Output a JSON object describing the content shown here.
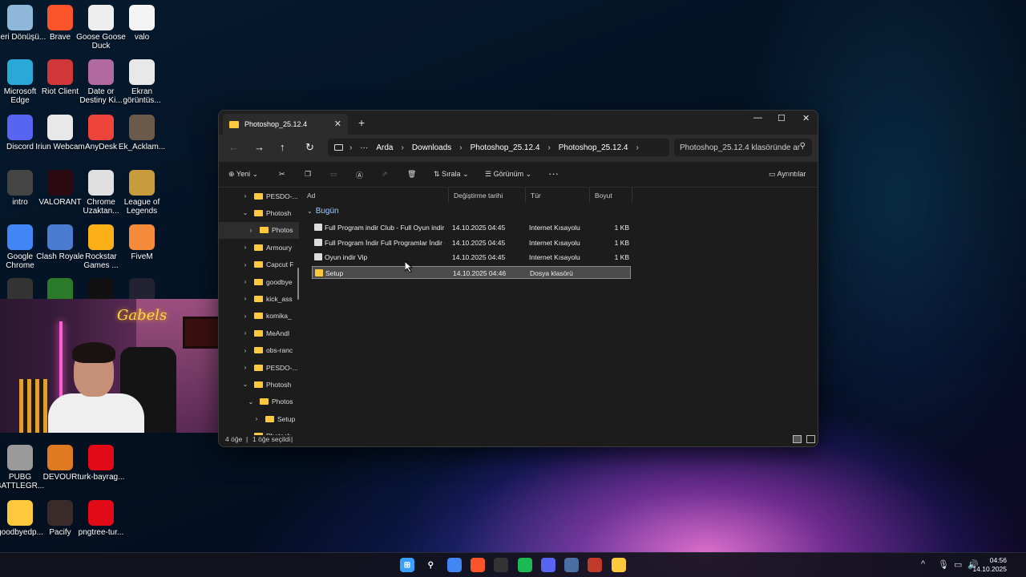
{
  "desktop_icons": [
    {
      "label": "Geri Dönüşü...",
      "icon": "recycle-bin-icon",
      "color": "#8fb7d9"
    },
    {
      "label": "Brave",
      "icon": "brave-icon",
      "color": "#fb542b"
    },
    {
      "label": "Goose Goose Duck",
      "icon": "goose-icon",
      "color": "#eeeeee"
    },
    {
      "label": "valo",
      "icon": "text-file-icon",
      "color": "#f4f4f4"
    },
    {
      "label": "Microsoft Edge",
      "icon": "edge-icon",
      "color": "#2aa8d8"
    },
    {
      "label": "Riot Client",
      "icon": "riot-icon",
      "color": "#d13639"
    },
    {
      "label": "Date or Destiny Ki...",
      "icon": "game-icon",
      "color": "#b06aa0"
    },
    {
      "label": "Ekran görüntüs...",
      "icon": "image-icon",
      "color": "#e8e8e8"
    },
    {
      "label": "Discord",
      "icon": "discord-icon",
      "color": "#5865f2"
    },
    {
      "label": "Iriun Webcam",
      "icon": "webcam-icon",
      "color": "#e8e8e8"
    },
    {
      "label": "AnyDesk",
      "icon": "anydesk-icon",
      "color": "#ef443b"
    },
    {
      "label": "Ek_Acklam...",
      "icon": "photo-icon",
      "color": "#6b5a4a"
    },
    {
      "label": "intro",
      "icon": "video-icon",
      "color": "#444444"
    },
    {
      "label": "VALORANT",
      "icon": "valorant-icon",
      "color": "#2a0a10"
    },
    {
      "label": "Chrome Uzaktan...",
      "icon": "chrome-remote-icon",
      "color": "#e0e0e0"
    },
    {
      "label": "League of Legends",
      "icon": "lol-icon",
      "color": "#c89b3c"
    },
    {
      "label": "Google Chrome",
      "icon": "chrome-icon",
      "color": "#4285f4"
    },
    {
      "label": "Clash Royale",
      "icon": "clash-icon",
      "color": "#4a7bd0"
    },
    {
      "label": "Rockstar Games ...",
      "icon": "rockstar-icon",
      "color": "#fcaf17"
    },
    {
      "label": "FiveM",
      "icon": "fivem-icon",
      "color": "#f58a3a"
    },
    {
      "label": "PUBG BATTLEGR...",
      "icon": "pubg-icon",
      "color": "#9a9a9a"
    },
    {
      "label": "DEVOUR",
      "icon": "devour-icon",
      "color": "#e07a20"
    },
    {
      "label": "turk-bayrag...",
      "icon": "flag-icon",
      "color": "#e30a17"
    },
    {
      "label": "goodbyedp...",
      "icon": "folder-icon",
      "color": "#ffc83d"
    },
    {
      "label": "Pacify",
      "icon": "pacify-icon",
      "color": "#3a2a2a"
    },
    {
      "label": "pngtree-tur...",
      "icon": "flag-icon",
      "color": "#e30a17"
    }
  ],
  "webcam_overlay": {
    "neon_text": "Gabels"
  },
  "explorer": {
    "tab_title": "Photoshop_25.12.4",
    "new_tab": "+",
    "window_controls": {
      "minimize": "—",
      "maximize": "☐",
      "close": "✕"
    },
    "nav": {
      "back": "←",
      "forward": "→",
      "up": "↑",
      "refresh": "↻",
      "more": "···"
    },
    "breadcrumb": [
      "Arda",
      "Downloads",
      "Photoshop_25.12.4",
      "Photoshop_25.12.4"
    ],
    "search_placeholder": "Photoshop_25.12.4 klasöründe ar",
    "toolbar": {
      "new_label": "Yeni",
      "sort_label": "Sırala",
      "view_label": "Görünüm",
      "more": "···",
      "details_label": "Ayrıntılar"
    },
    "nav_pane": [
      {
        "label": "PESDO-...",
        "chevron": "›"
      },
      {
        "label": "Photosh",
        "chevron": "⌄"
      },
      {
        "label": "Photos",
        "chevron": "›"
      },
      {
        "label": "Armoury",
        "chevron": "›"
      },
      {
        "label": "Capcut F",
        "chevron": "›"
      },
      {
        "label": "goodbye",
        "chevron": "›"
      },
      {
        "label": "kick_ass",
        "chevron": "›"
      },
      {
        "label": "komika_",
        "chevron": "›"
      },
      {
        "label": "MeAndI",
        "chevron": "›"
      },
      {
        "label": "obs-ranc",
        "chevron": "›"
      },
      {
        "label": "PESDO-...",
        "chevron": "›"
      },
      {
        "label": "Photosh",
        "chevron": "⌄"
      },
      {
        "label": "Photos",
        "chevron": "⌄"
      },
      {
        "label": "Setup",
        "chevron": "›"
      },
      {
        "label": "Photosh",
        "chevron": "›"
      }
    ],
    "columns": [
      "Ad",
      "Değiştirme tarihi",
      "Tür",
      "Boyut"
    ],
    "group_label": "Bugün",
    "files": [
      {
        "name": "Full Program indir Club - Full Oyun indir",
        "date": "14.10.2025 04:45",
        "type": "Internet Kısayolu",
        "size": "1 KB",
        "kind": "link"
      },
      {
        "name": "Full Program İndir Full Programlar İndir - ...",
        "date": "14.10.2025 04:45",
        "type": "Internet Kısayolu",
        "size": "1 KB",
        "kind": "link"
      },
      {
        "name": "Oyun indir Vip",
        "date": "14.10.2025 04:45",
        "type": "Internet Kısayolu",
        "size": "1 KB",
        "kind": "link"
      },
      {
        "name": "Setup",
        "date": "14.10.2025 04:46",
        "type": "Dosya klasörü",
        "size": "",
        "kind": "folder"
      }
    ],
    "status": {
      "count": "4 öğe",
      "selected": "1 öğe seçildi"
    }
  },
  "taskbar": {
    "apps": [
      "start-icon",
      "search-icon",
      "chrome-icon",
      "brave-icon",
      "obs-icon",
      "spotify-icon",
      "discord-icon",
      "settings-icon",
      "app-icon",
      "file-explorer-icon"
    ],
    "tray": {
      "chevron": "^"
    },
    "time": "04:56",
    "date": "14.10.2025"
  }
}
